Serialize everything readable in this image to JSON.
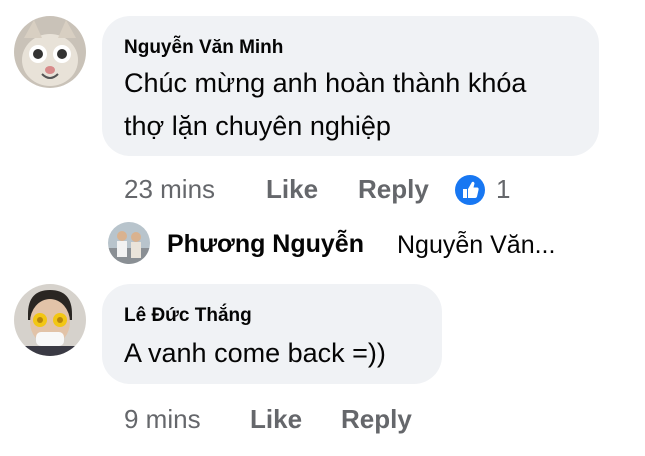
{
  "comment1": {
    "author": "Nguyễn Văn Minh",
    "line1": "Chúc mừng anh hoàn thành khóa",
    "line2": "thợ lặn chuyên nghiệp",
    "time": "23 mins",
    "like_label": "Like",
    "reply_label": "Reply",
    "reaction_icon": "thumbs-up-icon",
    "reaction_count": "1"
  },
  "reply_preview": {
    "author": "Phương Nguyễn",
    "text": "Nguyễn Văn..."
  },
  "comment2": {
    "author": "Lê Đức Thắng",
    "line1": "A vanh come back =))",
    "time": "9 mins",
    "like_label": "Like",
    "reply_label": "Reply"
  },
  "colors": {
    "bubble": "#f0f2f5",
    "meta_text": "#65676b",
    "reaction_blue": "#1877f2"
  }
}
